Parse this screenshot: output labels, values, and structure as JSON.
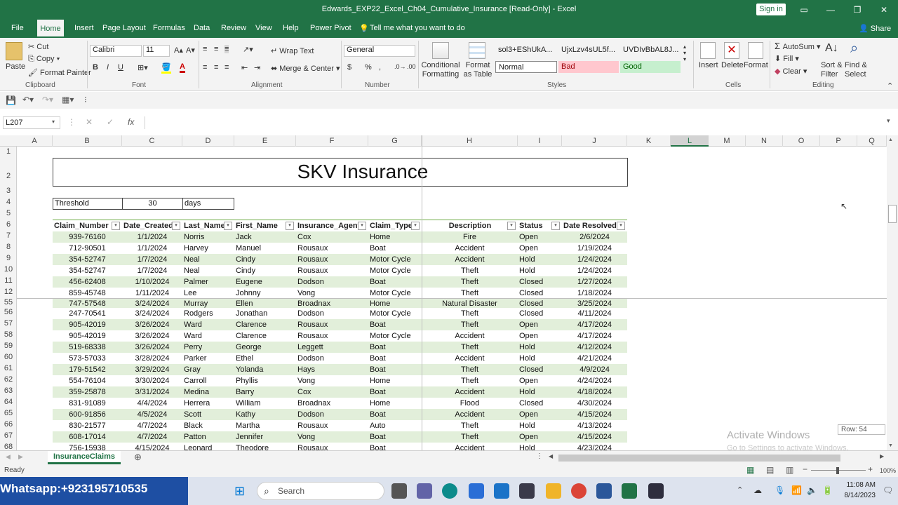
{
  "window": {
    "title": "Edwards_EXP22_Excel_Ch04_Cumulative_Insurance  [Read-Only]  -  Excel",
    "signin_label": "Sign in",
    "share_label": "Share"
  },
  "menu": {
    "file": "File",
    "home": "Home",
    "insert": "Insert",
    "page_layout": "Page Layout",
    "formulas": "Formulas",
    "data": "Data",
    "review": "Review",
    "view": "View",
    "help": "Help",
    "power_pivot": "Power Pivot",
    "tell_me": "Tell me what you want to do"
  },
  "ribbon": {
    "clipboard": {
      "paste": "Paste",
      "cut": "Cut",
      "copy": "Copy",
      "format_painter": "Format Painter",
      "group": "Clipboard"
    },
    "font": {
      "name": "Calibri",
      "size": "11",
      "group": "Font",
      "bold": "B",
      "italic": "I",
      "underline": "U"
    },
    "alignment": {
      "wrap_text": "Wrap Text",
      "merge_center": "Merge & Center",
      "group": "Alignment"
    },
    "number": {
      "format": "General",
      "currency": "$",
      "percent": "%",
      "comma": ",",
      "group": "Number"
    },
    "styles": {
      "conditional_formatting": "Conditional Formatting",
      "format_as_table": "Format as Table",
      "cell_style_1": "sol3+EShUkA...",
      "cell_style_2": "UjxLzv4sUL5f...",
      "cell_style_3": "UVDIvBbAL8J...",
      "normal": "Normal",
      "bad": "Bad",
      "good": "Good",
      "group": "Styles"
    },
    "cells": {
      "insert": "Insert",
      "delete": "Delete",
      "format": "Format",
      "group": "Cells"
    },
    "editing": {
      "autosum": "AutoSum",
      "fill": "Fill",
      "clear": "Clear",
      "sort_filter": "Sort & Filter",
      "find_select": "Find & Select",
      "group": "Editing"
    }
  },
  "formula_bar": {
    "name_box": "L207",
    "fx": "fx",
    "formula": ""
  },
  "columns": [
    "A",
    "B",
    "C",
    "D",
    "E",
    "F",
    "G",
    "H",
    "I",
    "J",
    "K",
    "L",
    "M",
    "N",
    "O",
    "P",
    "Q"
  ],
  "sheet": {
    "title": "SKV Insurance",
    "threshold_label": "Threshold",
    "threshold_value": "30",
    "threshold_unit": "days",
    "headers": [
      "Claim_Number",
      "Date_Created",
      "Last_Name",
      "First_Name",
      "Insurance_Agent",
      "Claim_Type",
      "Description",
      "Status",
      "Date Resolved"
    ],
    "top_row_numbers": [
      "1",
      "2",
      "3",
      "4",
      "5",
      "6"
    ],
    "rows": [
      {
        "n": "7",
        "cells": [
          "939-76160",
          "1/1/2024",
          "Norris",
          "Jack",
          "Cox",
          "Home",
          "Fire",
          "Open",
          "2/6/2024"
        ]
      },
      {
        "n": "8",
        "cells": [
          "712-90501",
          "1/1/2024",
          "Harvey",
          "Manuel",
          "Rousaux",
          "Boat",
          "Accident",
          "Open",
          "1/19/2024"
        ]
      },
      {
        "n": "9",
        "cells": [
          "354-52747",
          "1/7/2024",
          "Neal",
          "Cindy",
          "Rousaux",
          "Motor Cycle",
          "Accident",
          "Hold",
          "1/24/2024"
        ]
      },
      {
        "n": "10",
        "cells": [
          "354-52747",
          "1/7/2024",
          "Neal",
          "Cindy",
          "Rousaux",
          "Motor Cycle",
          "Theft",
          "Hold",
          "1/24/2024"
        ]
      },
      {
        "n": "11",
        "cells": [
          "456-62408",
          "1/10/2024",
          "Palmer",
          "Eugene",
          "Dodson",
          "Boat",
          "Theft",
          "Closed",
          "1/27/2024"
        ]
      },
      {
        "n": "12",
        "cells": [
          "859-45748",
          "1/11/2024",
          "Lee",
          "Johnny",
          "Vong",
          "Motor Cycle",
          "Theft",
          "Closed",
          "1/18/2024"
        ]
      },
      {
        "n": "55",
        "cells": [
          "747-57548",
          "3/24/2024",
          "Murray",
          "Ellen",
          "Broadnax",
          "Home",
          "Natural Disaster",
          "Closed",
          "3/25/2024"
        ]
      },
      {
        "n": "56",
        "cells": [
          "247-70541",
          "3/24/2024",
          "Rodgers",
          "Jonathan",
          "Dodson",
          "Motor Cycle",
          "Theft",
          "Closed",
          "4/11/2024"
        ]
      },
      {
        "n": "57",
        "cells": [
          "905-42019",
          "3/26/2024",
          "Ward",
          "Clarence",
          "Rousaux",
          "Boat",
          "Theft",
          "Open",
          "4/17/2024"
        ]
      },
      {
        "n": "58",
        "cells": [
          "905-42019",
          "3/26/2024",
          "Ward",
          "Clarence",
          "Rousaux",
          "Motor Cycle",
          "Accident",
          "Open",
          "4/17/2024"
        ]
      },
      {
        "n": "59",
        "cells": [
          "519-68338",
          "3/26/2024",
          "Perry",
          "George",
          "Leggett",
          "Boat",
          "Theft",
          "Hold",
          "4/12/2024"
        ]
      },
      {
        "n": "60",
        "cells": [
          "573-57033",
          "3/28/2024",
          "Parker",
          "Ethel",
          "Dodson",
          "Boat",
          "Accident",
          "Hold",
          "4/21/2024"
        ]
      },
      {
        "n": "61",
        "cells": [
          "179-51542",
          "3/29/2024",
          "Gray",
          "Yolanda",
          "Hays",
          "Boat",
          "Theft",
          "Closed",
          "4/9/2024"
        ]
      },
      {
        "n": "62",
        "cells": [
          "554-76104",
          "3/30/2024",
          "Carroll",
          "Phyllis",
          "Vong",
          "Home",
          "Theft",
          "Open",
          "4/24/2024"
        ]
      },
      {
        "n": "63",
        "cells": [
          "359-25878",
          "3/31/2024",
          "Medina",
          "Barry",
          "Cox",
          "Boat",
          "Accident",
          "Hold",
          "4/18/2024"
        ]
      },
      {
        "n": "64",
        "cells": [
          "831-91089",
          "4/4/2024",
          "Herrera",
          "William",
          "Broadnax",
          "Home",
          "Flood",
          "Closed",
          "4/30/2024"
        ]
      },
      {
        "n": "65",
        "cells": [
          "600-91856",
          "4/5/2024",
          "Scott",
          "Kathy",
          "Dodson",
          "Boat",
          "Accident",
          "Open",
          "4/15/2024"
        ]
      },
      {
        "n": "66",
        "cells": [
          "830-21577",
          "4/7/2024",
          "Black",
          "Martha",
          "Rousaux",
          "Auto",
          "Theft",
          "Hold",
          "4/13/2024"
        ]
      },
      {
        "n": "67",
        "cells": [
          "608-17014",
          "4/7/2024",
          "Patton",
          "Jennifer",
          "Vong",
          "Boat",
          "Theft",
          "Open",
          "4/15/2024"
        ]
      },
      {
        "n": "68",
        "cells": [
          "756-15938",
          "4/15/2024",
          "Leonard",
          "Theodore",
          "Rousaux",
          "Boat",
          "Accident",
          "Hold",
          "4/23/2024"
        ]
      }
    ]
  },
  "tooltip_row": "Row: 54",
  "activate": {
    "line1": "Activate Windows",
    "line2": "Go to Settings to activate Windows."
  },
  "sheet_tab": "InsuranceClaims",
  "status": {
    "ready": "Ready",
    "zoom": "100%"
  },
  "taskbar": {
    "whatsapp": "Whatsapp:+923195710535",
    "search": "Search",
    "time": "11:08 AM",
    "date": "8/14/2023"
  },
  "colors": {
    "excel_green": "#217346",
    "band_green": "#e2efda",
    "header_green": "#70ad47"
  }
}
